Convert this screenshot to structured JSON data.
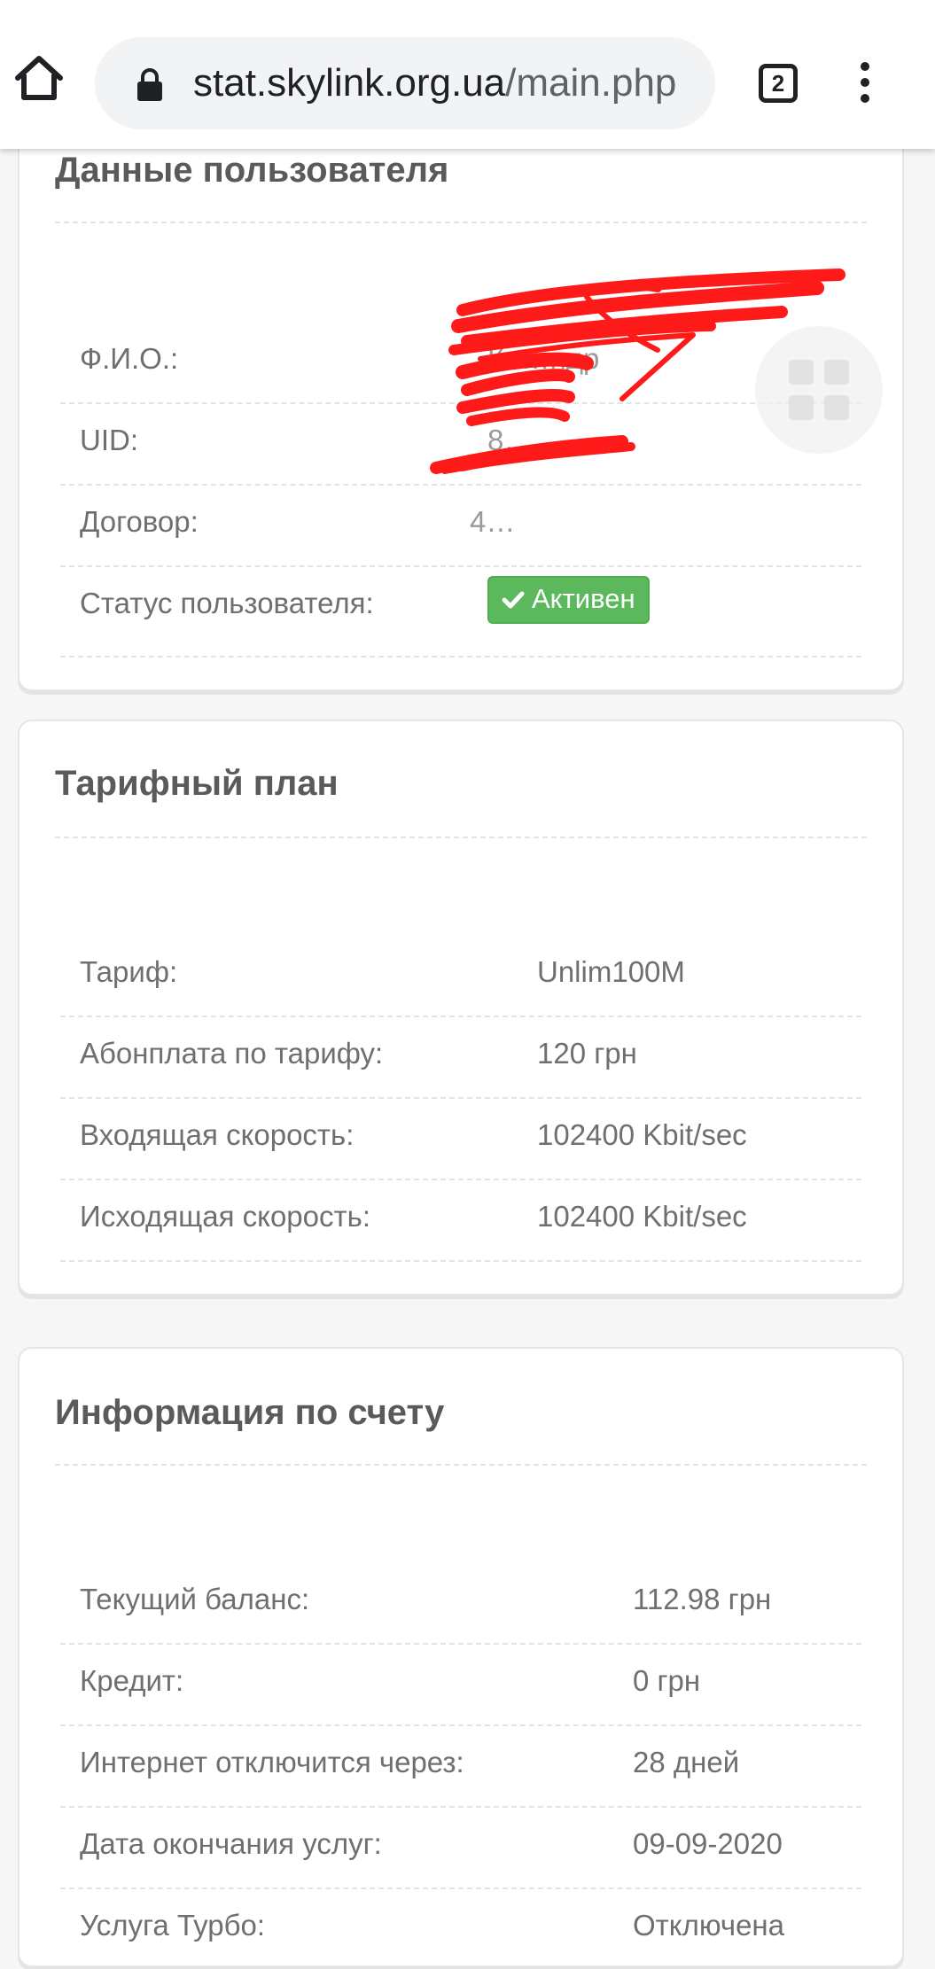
{
  "browser": {
    "url_host": "stat.skylink.org.ua",
    "url_path": "/main.php",
    "tab_count": "2"
  },
  "user_card": {
    "title": "Данные пользователя",
    "rows": [
      {
        "label": "Ф.И.О.:",
        "value": "Ко…ндр"
      },
      {
        "label": "UID:",
        "value": "8…"
      },
      {
        "label": "Договор:",
        "value": "4…"
      },
      {
        "label": "Статус пользователя:",
        "value": "Активен"
      }
    ]
  },
  "tariff_card": {
    "title": "Тарифный план",
    "rows": [
      {
        "label": "Тариф:",
        "value": "Unlim100M"
      },
      {
        "label": "Абонплата по тарифу:",
        "value": "120 грн"
      },
      {
        "label": "Входящая скорость:",
        "value": "102400 Kbit/sec"
      },
      {
        "label": "Исходящая скорость:",
        "value": "102400 Kbit/sec"
      }
    ]
  },
  "account_card": {
    "title": "Информация по счету",
    "rows": [
      {
        "label": "Текущий баланс:",
        "value": "112.98 грн"
      },
      {
        "label": "Кредит:",
        "value": "0 грн"
      },
      {
        "label": "Интернет отключится через:",
        "value": "28 дней"
      },
      {
        "label": "Дата окончания услуг:",
        "value": "09-09-2020"
      },
      {
        "label": "Услуга Турбо:",
        "value": "Отключена"
      }
    ]
  },
  "colors": {
    "badge_green": "#5cb85c",
    "redaction_red": "#ff1a1a"
  }
}
